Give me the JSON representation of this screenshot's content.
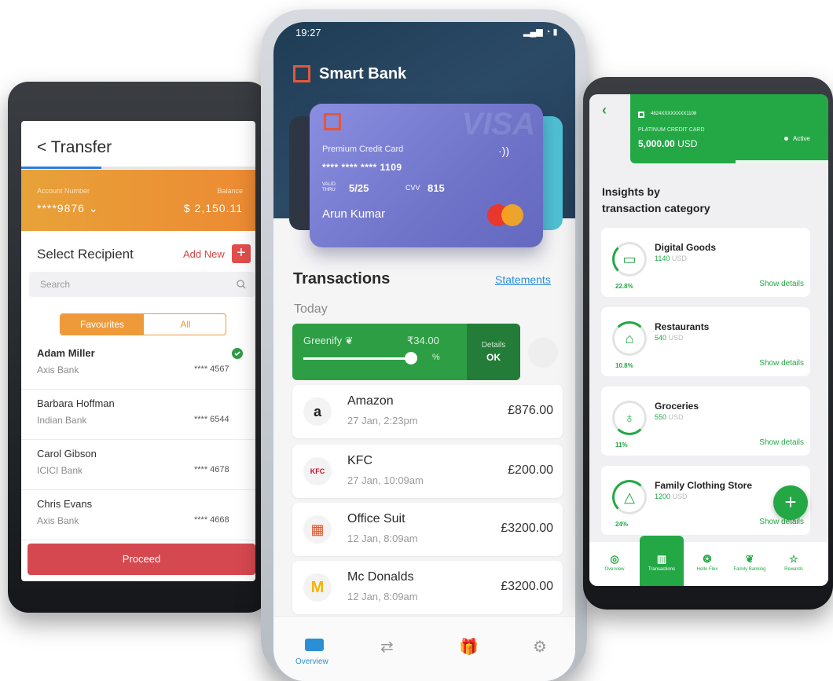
{
  "left": {
    "title": "Transfer",
    "back": "<",
    "account_number_label": "Account Number",
    "account_number": "****9876",
    "balance_label": "Balance",
    "balance": "$ 2,150.11",
    "select_recipient": "Select Recipient",
    "add_new": "Add New",
    "add_icon": "+",
    "search_placeholder": "Search",
    "tabs": [
      "Favourites",
      "All"
    ],
    "recipients": [
      {
        "name": "Adam Miller",
        "bank": "Axis Bank",
        "acct": "**** 4567"
      },
      {
        "name": "Barbara Hoffman",
        "bank": "Indian Bank",
        "acct": "**** 6544"
      },
      {
        "name": "Carol Gibson",
        "bank": "ICICI Bank",
        "acct": "**** 4678"
      },
      {
        "name": "Chris Evans",
        "bank": "Axis Bank",
        "acct": "**** 4668"
      }
    ],
    "proceed": "Proceed"
  },
  "middle": {
    "time": "19:27",
    "brand": "Smart Bank",
    "card": {
      "type": "Premium Credit Card",
      "number": "**** **** **** 1109",
      "valid_label": "VALID THRU",
      "valid": "5/25",
      "cvv_label": "CVV",
      "cvv": "815",
      "holder": "Arun Kumar",
      "network_watermark": "VISA"
    },
    "transactions_title": "Transactions",
    "statements": "Statements",
    "today": "Today",
    "greenify": {
      "label": "Greenify",
      "amount": "₹34.00",
      "unit": "%",
      "details": "Details",
      "ok": "OK"
    },
    "rows": [
      {
        "icon": "a",
        "name": "Amazon",
        "date": "27 Jan, 2:23pm",
        "amount": "£876.00"
      },
      {
        "icon": "KFC",
        "name": "KFC",
        "date": "27 Jan, 10:09am",
        "amount": "£200.00"
      },
      {
        "icon": "▦",
        "name": "Office Suit",
        "date": "12 Jan, 8:09am",
        "amount": "£3200.00"
      },
      {
        "icon": "M",
        "name": "Mc Donalds",
        "date": "12 Jan, 8:09am",
        "amount": "£3200.00"
      }
    ],
    "nav": [
      "Overview"
    ]
  },
  "right": {
    "card_number": "4824XXXXXXXX1108",
    "card_type": "PLATINUM CREDIT CARD",
    "balance": "5,000.00",
    "currency": "USD",
    "status": "Active",
    "title_line1": "Insights by",
    "title_line2": "transaction category",
    "categories": [
      {
        "name": "Digital Goods",
        "amount": "1140",
        "currency": "USD",
        "percent": "22.8%",
        "link": "Show details"
      },
      {
        "name": "Restaurants",
        "amount": "540",
        "currency": "USD",
        "percent": "10.8%",
        "link": "Show details"
      },
      {
        "name": "Groceries",
        "amount": "550",
        "currency": "USD",
        "percent": "11%",
        "link": "Show details"
      },
      {
        "name": "Family Clothing Store",
        "amount": "1200",
        "currency": "USD",
        "percent": "24%",
        "link": "Show details"
      }
    ],
    "nav": [
      "Overview",
      "Transactions",
      "Hello Flex",
      "Family Banking",
      "Rewards"
    ]
  }
}
